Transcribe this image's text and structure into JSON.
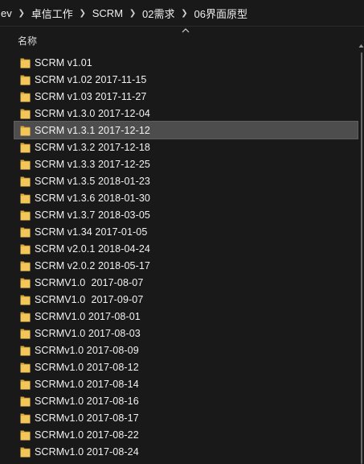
{
  "breadcrumb": {
    "items": [
      "ev",
      "卓信工作",
      "SCRM",
      "02需求",
      "06界面原型"
    ]
  },
  "header": {
    "name_column": "名称",
    "sort_icon": "chevron-up-icon"
  },
  "colors": {
    "background": "#191919",
    "selected_row": "#4d4d4d",
    "folder": "#f2c658",
    "folder_dark": "#d9a93b"
  },
  "files": [
    {
      "name": "SCRM v1.01",
      "selected": false
    },
    {
      "name": "SCRM v1.02 2017-11-15",
      "selected": false
    },
    {
      "name": "SCRM v1.03 2017-11-27",
      "selected": false
    },
    {
      "name": "SCRM v1.3.0 2017-12-04",
      "selected": false
    },
    {
      "name": "SCRM v1.3.1 2017-12-12",
      "selected": true
    },
    {
      "name": "SCRM v1.3.2 2017-12-18",
      "selected": false
    },
    {
      "name": "SCRM v1.3.3 2017-12-25",
      "selected": false
    },
    {
      "name": "SCRM v1.3.5 2018-01-23",
      "selected": false
    },
    {
      "name": "SCRM v1.3.6 2018-01-30",
      "selected": false
    },
    {
      "name": "SCRM v1.3.7 2018-03-05",
      "selected": false
    },
    {
      "name": "SCRM v1.34 2017-01-05",
      "selected": false
    },
    {
      "name": "SCRM v2.0.1 2018-04-24",
      "selected": false
    },
    {
      "name": "SCRM v2.0.2 2018-05-17",
      "selected": false
    },
    {
      "name": "SCRMV1.0  2017-08-07",
      "selected": false
    },
    {
      "name": "SCRMV1.0  2017-09-07",
      "selected": false
    },
    {
      "name": "SCRMV1.0 2017-08-01",
      "selected": false
    },
    {
      "name": "SCRMV1.0 2017-08-03",
      "selected": false
    },
    {
      "name": "SCRMv1.0 2017-08-09",
      "selected": false
    },
    {
      "name": "SCRMv1.0 2017-08-12",
      "selected": false
    },
    {
      "name": "SCRMv1.0 2017-08-14",
      "selected": false
    },
    {
      "name": "SCRMv1.0 2017-08-16",
      "selected": false
    },
    {
      "name": "SCRMv1.0 2017-08-17",
      "selected": false
    },
    {
      "name": "SCRMv1.0 2017-08-22",
      "selected": false
    },
    {
      "name": "SCRMv1.0 2017-08-24",
      "selected": false
    }
  ]
}
